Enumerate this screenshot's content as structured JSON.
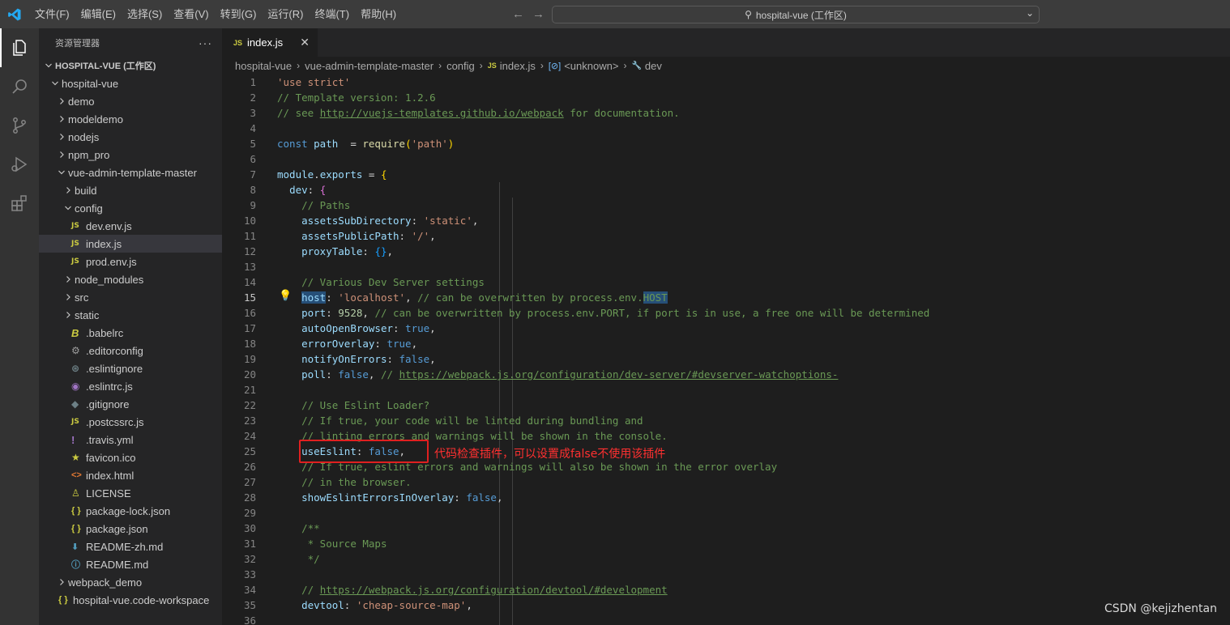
{
  "titlebar": {
    "menu": [
      "文件(F)",
      "编辑(E)",
      "选择(S)",
      "查看(V)",
      "转到(G)",
      "运行(R)",
      "终端(T)",
      "帮助(H)"
    ],
    "back": "←",
    "forward": "→",
    "search_text": "hospital-vue (工作区)"
  },
  "activitybar": {
    "items": [
      "explorer-icon",
      "search-icon",
      "source-control-icon",
      "run-debug-icon",
      "extensions-icon"
    ]
  },
  "sidebar": {
    "title": "资源管理器",
    "more": "···",
    "tree": [
      {
        "label": "HOSPITAL-VUE (工作区)",
        "depth": 0,
        "type": "root",
        "open": true
      },
      {
        "label": "hospital-vue",
        "depth": 1,
        "type": "folder",
        "open": true
      },
      {
        "label": "demo",
        "depth": 2,
        "type": "folder",
        "open": false
      },
      {
        "label": "modeldemo",
        "depth": 2,
        "type": "folder",
        "open": false
      },
      {
        "label": "nodejs",
        "depth": 2,
        "type": "folder",
        "open": false
      },
      {
        "label": "npm_pro",
        "depth": 2,
        "type": "folder",
        "open": false
      },
      {
        "label": "vue-admin-template-master",
        "depth": 2,
        "type": "folder",
        "open": true
      },
      {
        "label": "build",
        "depth": 3,
        "type": "folder",
        "open": false
      },
      {
        "label": "config",
        "depth": 3,
        "type": "folder",
        "open": true
      },
      {
        "label": "dev.env.js",
        "depth": 4,
        "type": "js"
      },
      {
        "label": "index.js",
        "depth": 4,
        "type": "js",
        "selected": true
      },
      {
        "label": "prod.env.js",
        "depth": 4,
        "type": "js"
      },
      {
        "label": "node_modules",
        "depth": 3,
        "type": "folder",
        "open": false
      },
      {
        "label": "src",
        "depth": 3,
        "type": "folder",
        "open": false
      },
      {
        "label": "static",
        "depth": 3,
        "type": "folder",
        "open": false
      },
      {
        "label": ".babelrc",
        "depth": 3,
        "type": "babel"
      },
      {
        "label": ".editorconfig",
        "depth": 3,
        "type": "gear"
      },
      {
        "label": ".eslintignore",
        "depth": 3,
        "type": "ignore"
      },
      {
        "label": ".eslintrc.js",
        "depth": 3,
        "type": "eslint"
      },
      {
        "label": ".gitignore",
        "depth": 3,
        "type": "git"
      },
      {
        "label": ".postcssrc.js",
        "depth": 3,
        "type": "js"
      },
      {
        "label": ".travis.yml",
        "depth": 3,
        "type": "yml"
      },
      {
        "label": "favicon.ico",
        "depth": 3,
        "type": "ico"
      },
      {
        "label": "index.html",
        "depth": 3,
        "type": "html"
      },
      {
        "label": "LICENSE",
        "depth": 3,
        "type": "lic"
      },
      {
        "label": "package-lock.json",
        "depth": 3,
        "type": "json"
      },
      {
        "label": "package.json",
        "depth": 3,
        "type": "json"
      },
      {
        "label": "README-zh.md",
        "depth": 3,
        "type": "mddown"
      },
      {
        "label": "README.md",
        "depth": 3,
        "type": "md"
      },
      {
        "label": "webpack_demo",
        "depth": 2,
        "type": "folder",
        "open": false
      },
      {
        "label": "hospital-vue.code-workspace",
        "depth": 1,
        "type": "json"
      }
    ]
  },
  "editor": {
    "tab": {
      "badge": "JS",
      "label": "index.js",
      "close": "✕"
    },
    "breadcrumb": [
      "hospital-vue",
      "vue-admin-template-master",
      "config",
      "index.js",
      "<unknown>",
      "dev"
    ],
    "current_line": 15,
    "lines": [
      [
        [
          "c-str",
          "'use strict'"
        ]
      ],
      [
        [
          "c-com",
          "// Template version: 1.2.6"
        ]
      ],
      [
        [
          "c-com",
          "// see "
        ],
        [
          "c-com c-link",
          "http://vuejs-templates.github.io/webpack"
        ],
        [
          "c-com",
          " for documentation."
        ]
      ],
      [],
      [
        [
          "c-key",
          "const "
        ],
        [
          "c-var",
          "path"
        ],
        [
          "",
          "  = "
        ],
        [
          "c-fn",
          "require"
        ],
        [
          "c-br",
          "("
        ],
        [
          "c-str",
          "'path'"
        ],
        [
          "c-br",
          ")"
        ]
      ],
      [],
      [
        [
          "c-var",
          "module"
        ],
        [
          "",
          "."
        ],
        [
          "c-var",
          "exports"
        ],
        [
          "",
          " = "
        ],
        [
          "c-br",
          "{"
        ]
      ],
      [
        [
          "",
          "  "
        ],
        [
          "c-var",
          "dev"
        ],
        [
          "",
          ": "
        ],
        [
          "c-br2",
          "{"
        ]
      ],
      [
        [
          "",
          "    "
        ],
        [
          "c-com",
          "// Paths"
        ]
      ],
      [
        [
          "",
          "    "
        ],
        [
          "c-var",
          "assetsSubDirectory"
        ],
        [
          "",
          ": "
        ],
        [
          "c-str",
          "'static'"
        ],
        [
          "",
          ","
        ]
      ],
      [
        [
          "",
          "    "
        ],
        [
          "c-var",
          "assetsPublicPath"
        ],
        [
          "",
          ": "
        ],
        [
          "c-str",
          "'/'"
        ],
        [
          "",
          ","
        ]
      ],
      [
        [
          "",
          "    "
        ],
        [
          "c-var",
          "proxyTable"
        ],
        [
          "",
          ": "
        ],
        [
          "c-br3",
          "{}"
        ],
        [
          "",
          ","
        ]
      ],
      [],
      [
        [
          "",
          "    "
        ],
        [
          "c-com",
          "// Various Dev Server settings"
        ]
      ],
      [
        [
          "",
          "    "
        ],
        [
          "c-var hl",
          "host"
        ],
        [
          "",
          ": "
        ],
        [
          "c-str",
          "'localhost'"
        ],
        [
          "",
          ", "
        ],
        [
          "c-com",
          "// can be overwritten by process.env."
        ],
        [
          "c-com hl",
          "HOST"
        ]
      ],
      [
        [
          "",
          "    "
        ],
        [
          "c-var",
          "port"
        ],
        [
          "",
          ": "
        ],
        [
          "c-num",
          "9528"
        ],
        [
          "",
          ", "
        ],
        [
          "c-com",
          "// can be overwritten by process.env.PORT, if port is in use, a free one will be determined"
        ]
      ],
      [
        [
          "",
          "    "
        ],
        [
          "c-var",
          "autoOpenBrowser"
        ],
        [
          "",
          ": "
        ],
        [
          "c-key",
          "true"
        ],
        [
          "",
          ","
        ]
      ],
      [
        [
          "",
          "    "
        ],
        [
          "c-var",
          "errorOverlay"
        ],
        [
          "",
          ": "
        ],
        [
          "c-key",
          "true"
        ],
        [
          "",
          ","
        ]
      ],
      [
        [
          "",
          "    "
        ],
        [
          "c-var",
          "notifyOnErrors"
        ],
        [
          "",
          ": "
        ],
        [
          "c-key",
          "false"
        ],
        [
          "",
          ","
        ]
      ],
      [
        [
          "",
          "    "
        ],
        [
          "c-var",
          "poll"
        ],
        [
          "",
          ": "
        ],
        [
          "c-key",
          "false"
        ],
        [
          "",
          ", "
        ],
        [
          "c-com",
          "// "
        ],
        [
          "c-com c-link",
          "https://webpack.js.org/configuration/dev-server/#devserver-watchoptions-"
        ]
      ],
      [],
      [
        [
          "",
          "    "
        ],
        [
          "c-com",
          "// Use Eslint Loader?"
        ]
      ],
      [
        [
          "",
          "    "
        ],
        [
          "c-com",
          "// If true, your code will be linted during bundling and"
        ]
      ],
      [
        [
          "",
          "    "
        ],
        [
          "c-com",
          "// linting errors and warnings will be shown in the console."
        ]
      ],
      [
        [
          "",
          "    "
        ],
        [
          "c-var",
          "useEslint"
        ],
        [
          "",
          ": "
        ],
        [
          "c-key",
          "false"
        ],
        [
          "",
          ","
        ]
      ],
      [
        [
          "",
          "    "
        ],
        [
          "c-com",
          "// If true, eslint errors and warnings will also be shown in the error overlay"
        ]
      ],
      [
        [
          "",
          "    "
        ],
        [
          "c-com",
          "// in the browser."
        ]
      ],
      [
        [
          "",
          "    "
        ],
        [
          "c-var",
          "showEslintErrorsInOverlay"
        ],
        [
          "",
          ": "
        ],
        [
          "c-key",
          "false"
        ],
        [
          "",
          ","
        ]
      ],
      [],
      [
        [
          "",
          "    "
        ],
        [
          "c-com",
          "/**"
        ]
      ],
      [
        [
          "",
          "    "
        ],
        [
          "c-com",
          " * Source Maps"
        ]
      ],
      [
        [
          "",
          "    "
        ],
        [
          "c-com",
          " */"
        ]
      ],
      [],
      [
        [
          "",
          "    "
        ],
        [
          "c-com",
          "// "
        ],
        [
          "c-com c-link",
          "https://webpack.js.org/configuration/devtool/#development"
        ]
      ],
      [
        [
          "",
          "    "
        ],
        [
          "c-var",
          "devtool"
        ],
        [
          "",
          ": "
        ],
        [
          "c-str",
          "'cheap-source-map'"
        ],
        [
          "",
          ","
        ]
      ],
      []
    ]
  },
  "annotation": {
    "text": "代码检查插件，可以设置成false不使用该插件"
  },
  "watermark": "CSDN @kejizhentan"
}
